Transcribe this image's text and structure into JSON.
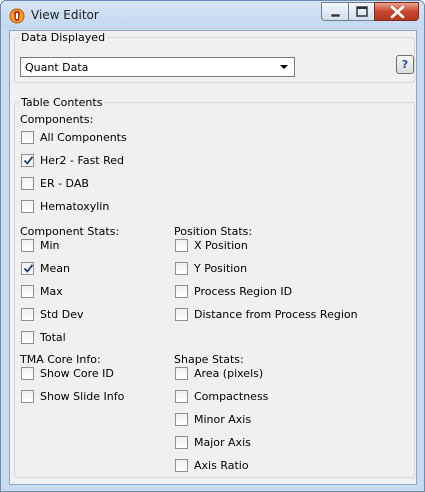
{
  "window": {
    "title": "View Editor",
    "icon": "app-logo-icon"
  },
  "data_displayed": {
    "group_label": "Data Displayed",
    "selected": "Quant Data",
    "help_label": "?"
  },
  "table_contents": {
    "group_label": "Table Contents",
    "components_label": "Components:",
    "components": [
      {
        "label": "All Components",
        "checked": false
      },
      {
        "label": "Her2 - Fast Red",
        "checked": true
      },
      {
        "label": "ER - DAB",
        "checked": false
      },
      {
        "label": "Hematoxylin",
        "checked": false
      }
    ],
    "component_stats_label": "Component Stats:",
    "component_stats": [
      {
        "label": "Min",
        "checked": false
      },
      {
        "label": "Mean",
        "checked": true
      },
      {
        "label": "Max",
        "checked": false
      },
      {
        "label": "Std Dev",
        "checked": false
      },
      {
        "label": "Total",
        "checked": false
      }
    ],
    "position_stats_label": "Position Stats:",
    "position_stats": [
      {
        "label": "X Position",
        "checked": false
      },
      {
        "label": "Y Position",
        "checked": false
      },
      {
        "label": "Process Region ID",
        "checked": false
      },
      {
        "label": "Distance from Process Region",
        "checked": false
      }
    ],
    "tma_label": "TMA Core Info:",
    "tma": [
      {
        "label": "Show Core ID",
        "checked": false
      },
      {
        "label": "Show Slide Info",
        "checked": false
      }
    ],
    "shape_stats_label": "Shape Stats:",
    "shape_stats": [
      {
        "label": "Area (pixels)",
        "checked": false
      },
      {
        "label": "Compactness",
        "checked": false
      },
      {
        "label": "Minor Axis",
        "checked": false
      },
      {
        "label": "Major Axis",
        "checked": false
      },
      {
        "label": "Axis Ratio",
        "checked": false
      }
    ]
  }
}
